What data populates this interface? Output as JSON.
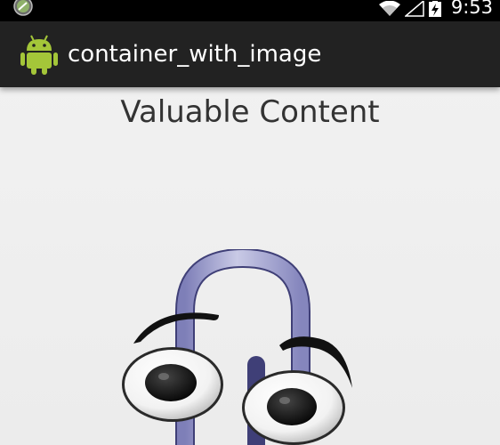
{
  "status_bar": {
    "time": "9:53",
    "icons": [
      "app-notification-icon",
      "wifi-icon",
      "signal-icon",
      "battery-charging-icon"
    ]
  },
  "action_bar": {
    "title": "container_with_image",
    "logo_icon": "android-robot-icon",
    "background": "#222222"
  },
  "content": {
    "text": "Valuable Content",
    "image": "paperclip-assistant-image"
  }
}
